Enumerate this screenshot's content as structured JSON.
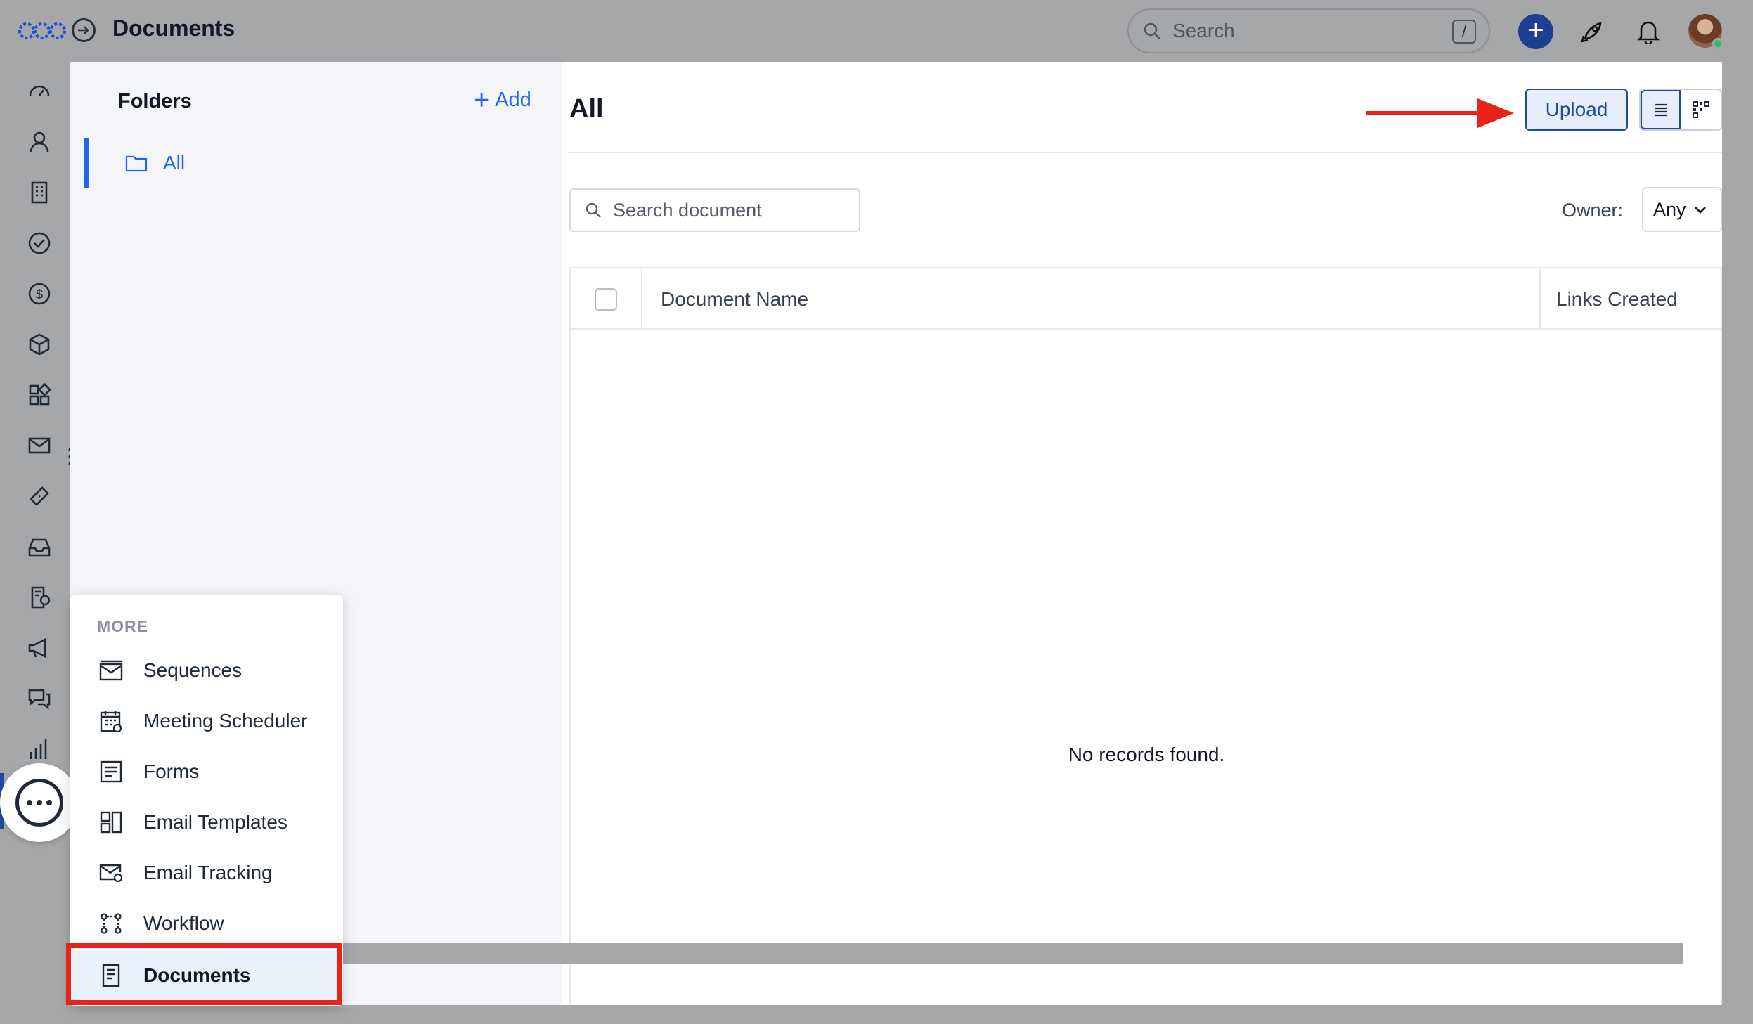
{
  "app": {
    "page_title": "Documents"
  },
  "topbar": {
    "search_placeholder": "Search",
    "shortcut_key": "/"
  },
  "sidebar_icons": [
    "dashboard-icon",
    "contacts-icon",
    "companies-icon",
    "tasks-icon",
    "deals-icon",
    "products-icon",
    "apps-icon",
    "email-icon",
    "tickets-icon",
    "inbox-icon",
    "reports-icon",
    "campaigns-icon",
    "chat-icon",
    "analytics-icon"
  ],
  "folders": {
    "title": "Folders",
    "add_label": "Add",
    "items": [
      {
        "label": "All",
        "active": true
      }
    ]
  },
  "main": {
    "title": "All",
    "upload_label": "Upload",
    "search_placeholder": "Search document",
    "owner_label": "Owner:",
    "owner_value": "Any",
    "table": {
      "columns": [
        "Document Name",
        "Links Created"
      ],
      "rows": [],
      "empty_message": "No records found."
    }
  },
  "more_menu": {
    "title": "MORE",
    "items": [
      {
        "label": "Sequences",
        "icon": "sequences-icon"
      },
      {
        "label": "Meeting Scheduler",
        "icon": "calendar-icon"
      },
      {
        "label": "Forms",
        "icon": "forms-icon"
      },
      {
        "label": "Email Templates",
        "icon": "templates-icon"
      },
      {
        "label": "Email Tracking",
        "icon": "email-tracking-icon"
      },
      {
        "label": "Workflow",
        "icon": "workflow-icon"
      },
      {
        "label": "Documents",
        "icon": "documents-icon",
        "selected": true
      }
    ]
  },
  "colors": {
    "accent": "#2563eb",
    "annotation": "#e8231a",
    "brand": "#1f4b99"
  }
}
